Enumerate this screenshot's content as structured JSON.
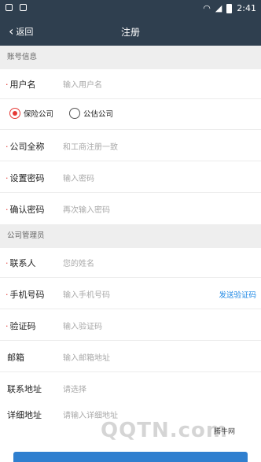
{
  "status_bar": {
    "time": "2:41"
  },
  "header": {
    "back_label": "返回",
    "title": "注册"
  },
  "sections": {
    "account": "账号信息",
    "manager": "公司管理员"
  },
  "account_fields": {
    "username": {
      "label": "用户名",
      "placeholder": "输入用户名",
      "required": true
    },
    "company_type": {
      "option1": "保险公司",
      "option2": "公估公司",
      "selected": "保险公司"
    },
    "company_name": {
      "label": "公司全称",
      "placeholder": "和工商注册一致",
      "required": true
    },
    "password": {
      "label": "设置密码",
      "placeholder": "输入密码",
      "required": true
    },
    "confirm_password": {
      "label": "确认密码",
      "placeholder": "再次输入密码",
      "required": true
    }
  },
  "manager_fields": {
    "contact": {
      "label": "联系人",
      "placeholder": "您的姓名",
      "required": true
    },
    "phone": {
      "label": "手机号码",
      "placeholder": "输入手机号码",
      "required": true,
      "action": "发送验证码"
    },
    "code": {
      "label": "验证码",
      "placeholder": "输入验证码",
      "required": true
    },
    "email": {
      "label": "邮箱",
      "placeholder": "输入邮箱地址"
    },
    "address": {
      "label": "联系地址",
      "placeholder": "请选择"
    },
    "detail_address": {
      "label": "详细地址",
      "placeholder": "请输入详细地址"
    }
  },
  "watermark": {
    "logo": "QQTN.com",
    "site": "腾牛网"
  },
  "colors": {
    "header_bg": "#2f3f4f",
    "required": "#e53935",
    "link": "#1e88e5"
  }
}
